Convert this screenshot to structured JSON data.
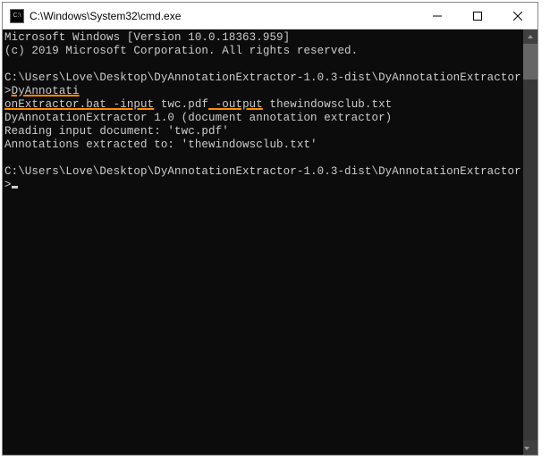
{
  "window": {
    "title": "C:\\Windows\\System32\\cmd.exe",
    "icon_label": "C:\\"
  },
  "console": {
    "header_line1": "Microsoft Windows [Version 10.0.18363.959]",
    "header_line2": "(c) 2019 Microsoft Corporation. All rights reserved.",
    "blank": " ",
    "prompt_path": "C:\\Users\\Love\\Desktop\\DyAnnotationExtractor-1.0.3-dist\\DyAnnotationExtractor>",
    "cmd_part1": "DyAnnotati",
    "cmd_part2": "onExtractor.bat",
    "cmd_part3": " -input",
    "cmd_part4": " twc.pdf",
    "cmd_part5": " -output",
    "cmd_part6": " thewindowsclub.txt",
    "out_line1": "DyAnnotationExtractor 1.0 (document annotation extractor)",
    "out_line2": "Reading input document: 'twc.pdf'",
    "out_line3": "Annotations extracted to: 'thewindowsclub.txt'",
    "prompt2_path": "C:\\Users\\Love\\Desktop\\DyAnnotationExtractor-1.0.3-dist\\DyAnnotationExtractor>"
  }
}
